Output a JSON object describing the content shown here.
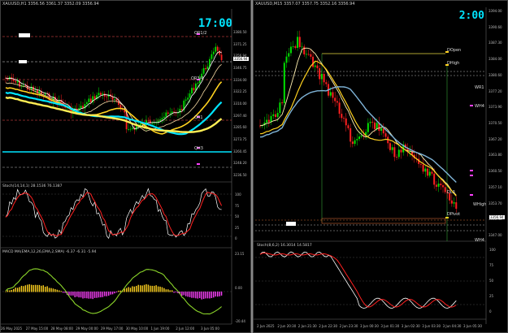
{
  "left_chart": {
    "title": "XAUUSD,H1  3356.56 3361.37 3352.09 3356.94",
    "clock": "17:00",
    "levels": [
      "QR1/2",
      "QR3/4",
      "QR1",
      "QH3"
    ],
    "price_ticks": [
      "3380.50",
      "3371.25",
      "3356.94",
      "3346.75",
      "3334.00",
      "3322.25",
      "3310.00",
      "3297.40",
      "3285.60",
      "3273.75",
      "3260.45",
      "3248.20",
      "3236.50"
    ],
    "current_price": "3356.94",
    "stoch_label": "Stoch(14,14,1) 28.1536 76.1387",
    "stoch_ticks": [
      "100",
      "75",
      "50",
      "25",
      "0"
    ],
    "macd_label": "MACD MA(EMA,12,26,EMA,2,SMA) -6.37 -6.31 -5.94",
    "macd_ticks": [
      "23.15",
      "0.00",
      "-20.44"
    ],
    "time_labels": [
      "26 May 2025",
      "27 May 15:00",
      "28 May 08:00",
      "29 May 00:00",
      "29 May 17:00",
      "30 May 10:00",
      "1 Jun 19:00",
      "2 Jun 12:00",
      "3 Jun 05:00"
    ]
  },
  "right_chart": {
    "title": "XAUUSD,M15  3357.07 3357.75 3352.16 3356.94",
    "clock": "2:00",
    "levels": [
      "DOpen",
      "DHigh",
      "WR1",
      "WH4",
      "DL3",
      "WHigh",
      "DPivot",
      "WH4"
    ],
    "price_ticks": [
      "3394.00",
      "3390.60",
      "3387.30",
      "3384.00",
      "3380.60",
      "3377.20",
      "3373.90",
      "3370.50",
      "3367.20",
      "3363.80",
      "3360.50",
      "3357.10",
      "3353.70",
      "3350.40",
      "3347.00"
    ],
    "current_price": "3356.94",
    "stoch_label": "Stoch(8,6,2) 16.3014 14.5817",
    "stoch_ticks": [
      "100",
      "75",
      "50",
      "25",
      "0"
    ],
    "time_labels": [
      "2 Jun 2025",
      "2 Jun 20:30",
      "2 Jun 21:30",
      "2 Jun 22:30",
      "2 Jun 23:30",
      "3 Jun 00:30",
      "3 Jun 01:30",
      "3 Jun 02:30",
      "3 Jun 03:30",
      "3 Jun 04:30",
      "3 Jun 05:30"
    ]
  },
  "colors": {
    "bull": "#00e000",
    "bear": "#ff2020",
    "ma_yellow": "#ffd21f",
    "ma_blue": "#7fb4d8",
    "ma_white": "#ffffff",
    "ma_cyan": "#00e5ff"
  }
}
